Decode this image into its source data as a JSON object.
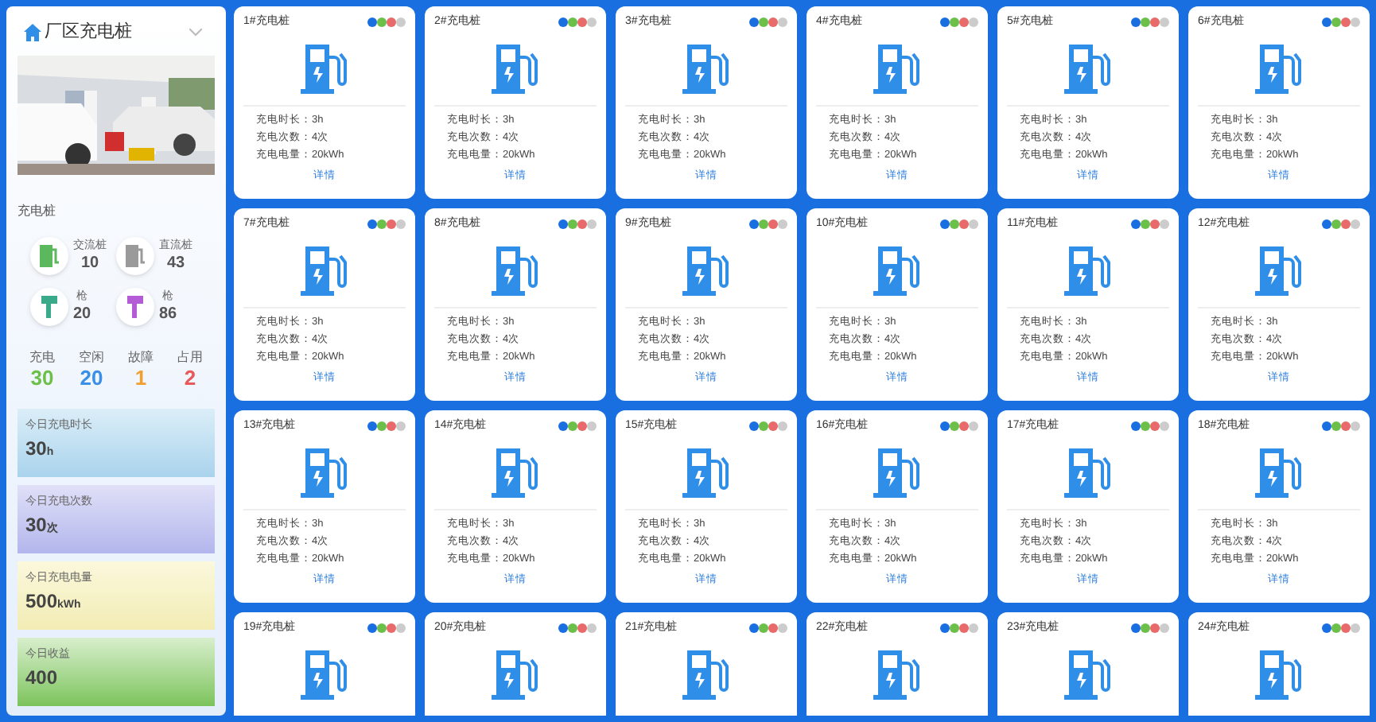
{
  "sidebar": {
    "title": "厂区充电桩",
    "section": "充电桩",
    "stats": [
      {
        "label": "交流桩",
        "value": "10",
        "kind": "ac",
        "color": "#5cb85c"
      },
      {
        "label": "直流桩",
        "value": "43",
        "kind": "dc",
        "color": "#9a9a9a"
      },
      {
        "label": "枪",
        "value": "20",
        "kind": "gun",
        "color": "#3aaa8a"
      },
      {
        "label": "枪",
        "value": "86",
        "kind": "gun",
        "color": "#b45cd6"
      }
    ],
    "statuses": [
      {
        "label": "充电",
        "value": "30",
        "color": "#6cc04a"
      },
      {
        "label": "空闲",
        "value": "20",
        "color": "#3b8fe6"
      },
      {
        "label": "故障",
        "value": "1",
        "color": "#f0a030"
      },
      {
        "label": "占用",
        "value": "2",
        "color": "#e85a5a"
      }
    ],
    "today": [
      {
        "label": "今日充电时长",
        "value": "30",
        "unit": "h",
        "kind": "sky"
      },
      {
        "label": "今日充电次数",
        "value": "30",
        "unit": "次",
        "kind": "violet"
      },
      {
        "label": "今日充电电量",
        "value": "500",
        "unit": "kWh",
        "kind": "lemon"
      },
      {
        "label": "今日收益",
        "value": "400",
        "kind": "grass"
      }
    ]
  },
  "chargers": [
    {
      "name": "1#充电桩",
      "lines": [
        "充电时长：3h",
        "充电次数：4次",
        "充电电量：20kWh"
      ],
      "link": "详情"
    },
    {
      "name": "2#充电桩",
      "lines": [
        "充电时长：3h",
        "充电次数：4次",
        "充电电量：20kWh"
      ],
      "link": "详情"
    },
    {
      "name": "3#充电桩",
      "lines": [
        "充电时长：3h",
        "充电次数：4次",
        "充电电量：20kWh"
      ],
      "link": "详情"
    },
    {
      "name": "4#充电桩",
      "lines": [
        "充电时长：3h",
        "充电次数：4次",
        "充电电量：20kWh"
      ],
      "link": "详情"
    },
    {
      "name": "5#充电桩",
      "lines": [
        "充电时长：3h",
        "充电次数：4次",
        "充电电量：20kWh"
      ],
      "link": "详情"
    },
    {
      "name": "6#充电桩",
      "lines": [
        "充电时长：3h",
        "充电次数：4次",
        "充电电量：20kWh"
      ],
      "link": "详情"
    },
    {
      "name": "7#充电桩",
      "lines": [
        "充电时长：3h",
        "充电次数：4次",
        "充电电量：20kWh"
      ],
      "link": "详情"
    },
    {
      "name": "8#充电桩",
      "lines": [
        "充电时长：3h",
        "充电次数：4次",
        "充电电量：20kWh"
      ],
      "link": "详情"
    },
    {
      "name": "9#充电桩",
      "lines": [
        "充电时长：3h",
        "充电次数：4次",
        "充电电量：20kWh"
      ],
      "link": "详情"
    },
    {
      "name": "10#充电桩",
      "lines": [
        "充电时长：3h",
        "充电次数：4次",
        "充电电量：20kWh"
      ],
      "link": "详情"
    },
    {
      "name": "11#充电桩",
      "lines": [
        "充电时长：3h",
        "充电次数：4次",
        "充电电量：20kWh"
      ],
      "link": "详情"
    },
    {
      "name": "12#充电桩",
      "lines": [
        "充电时长：3h",
        "充电次数：4次",
        "充电电量：20kWh"
      ],
      "link": "详情"
    },
    {
      "name": "13#充电桩",
      "lines": [
        "充电时长：3h",
        "充电次数：4次",
        "充电电量：20kWh"
      ],
      "link": "详情"
    },
    {
      "name": "14#充电桩",
      "lines": [
        "充电时长：3h",
        "充电次数：4次",
        "充电电量：20kWh"
      ],
      "link": "详情"
    },
    {
      "name": "15#充电桩",
      "lines": [
        "充电时长：3h",
        "充电次数：4次",
        "充电电量：20kWh"
      ],
      "link": "详情"
    },
    {
      "name": "16#充电桩",
      "lines": [
        "充电时长：3h",
        "充电次数：4次",
        "充电电量：20kWh"
      ],
      "link": "详情"
    },
    {
      "name": "17#充电桩",
      "lines": [
        "充电时长：3h",
        "充电次数：4次",
        "充电电量：20kWh"
      ],
      "link": "详情"
    },
    {
      "name": "18#充电桩",
      "lines": [
        "充电时长：3h",
        "充电次数：4次",
        "充电电量：20kWh"
      ],
      "link": "详情"
    },
    {
      "name": "19#充电桩"
    },
    {
      "name": "20#充电桩"
    },
    {
      "name": "21#充电桩"
    },
    {
      "name": "22#充电桩"
    },
    {
      "name": "23#充电桩"
    },
    {
      "name": "24#充电桩"
    }
  ],
  "status_dots": [
    {
      "color": "#1a6fe0"
    },
    {
      "color": "#6cc04a"
    },
    {
      "color": "#e86a6a"
    },
    {
      "color": "#cccccc"
    }
  ]
}
